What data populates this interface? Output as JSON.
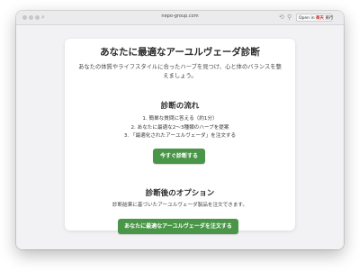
{
  "browser": {
    "url": "nepo-group.com",
    "open_in_prefix": "Open in",
    "open_in_brand": "楽天",
    "open_in_suffix": "旅行"
  },
  "page": {
    "title": "あなたに最適なアーユルヴェーダ診断",
    "subtitle": "あなたの体質やライフスタイルに合ったハーブを見つけ、心と体のバランスを整えましょう。",
    "flow_heading": "診断の流れ",
    "steps": [
      "1. 簡単な質問に答える（約1分）",
      "2. あなたに最適な2〜3種類のハーブを提案",
      "3. 「最適化されたアーユルヴェーダ」を注文する"
    ],
    "start_button": "今すぐ診断する",
    "options_heading": "診断後のオプション",
    "options_note": "診断結果に基づいたアーユルヴェーダ製品を注文できます。",
    "order_button": "あなたに最適なアーユルヴェーダを注文する"
  },
  "colors": {
    "button_green": "#4a9648",
    "card_bg": "#ffffff",
    "page_bg": "#f2f2f4"
  }
}
